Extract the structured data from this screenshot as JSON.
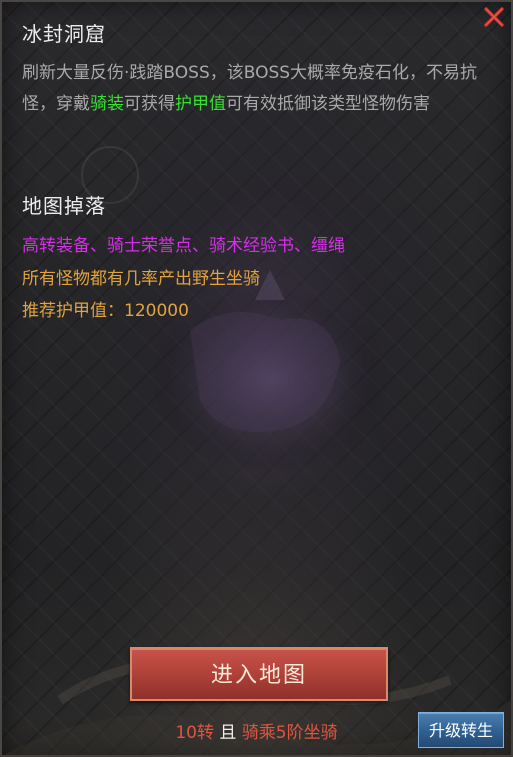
{
  "panel": {
    "title": "冰封洞窟",
    "close_icon": "close-x-icon"
  },
  "description": {
    "part1": "刷新大量反伤·践踏BOSS，该BOSS大概率免疫石化，不易抗怪，穿戴",
    "highlight1": "骑装",
    "part2": "可获得",
    "highlight2": "护甲值",
    "part3": "可有效抵御该类型怪物伤害",
    "highlight_color": "#35e22f"
  },
  "drops": {
    "section_title": "地图掉落",
    "purple_line": "高转装备、骑士荣誉点、骑术经验书、缰绳",
    "orange_line": "所有怪物都有几率产出野生坐骑",
    "recommend_line": "推荐护甲值：120000"
  },
  "actions": {
    "enter_label": "进入地图",
    "upgrade_label": "升级转生"
  },
  "requirements": {
    "rebirth": "10转",
    "conjunction": "且",
    "mount": "骑乘5阶坐骑"
  },
  "colors": {
    "purple": "#d530e8",
    "orange": "#e0a33e",
    "requirement_red": "#e0553f"
  }
}
